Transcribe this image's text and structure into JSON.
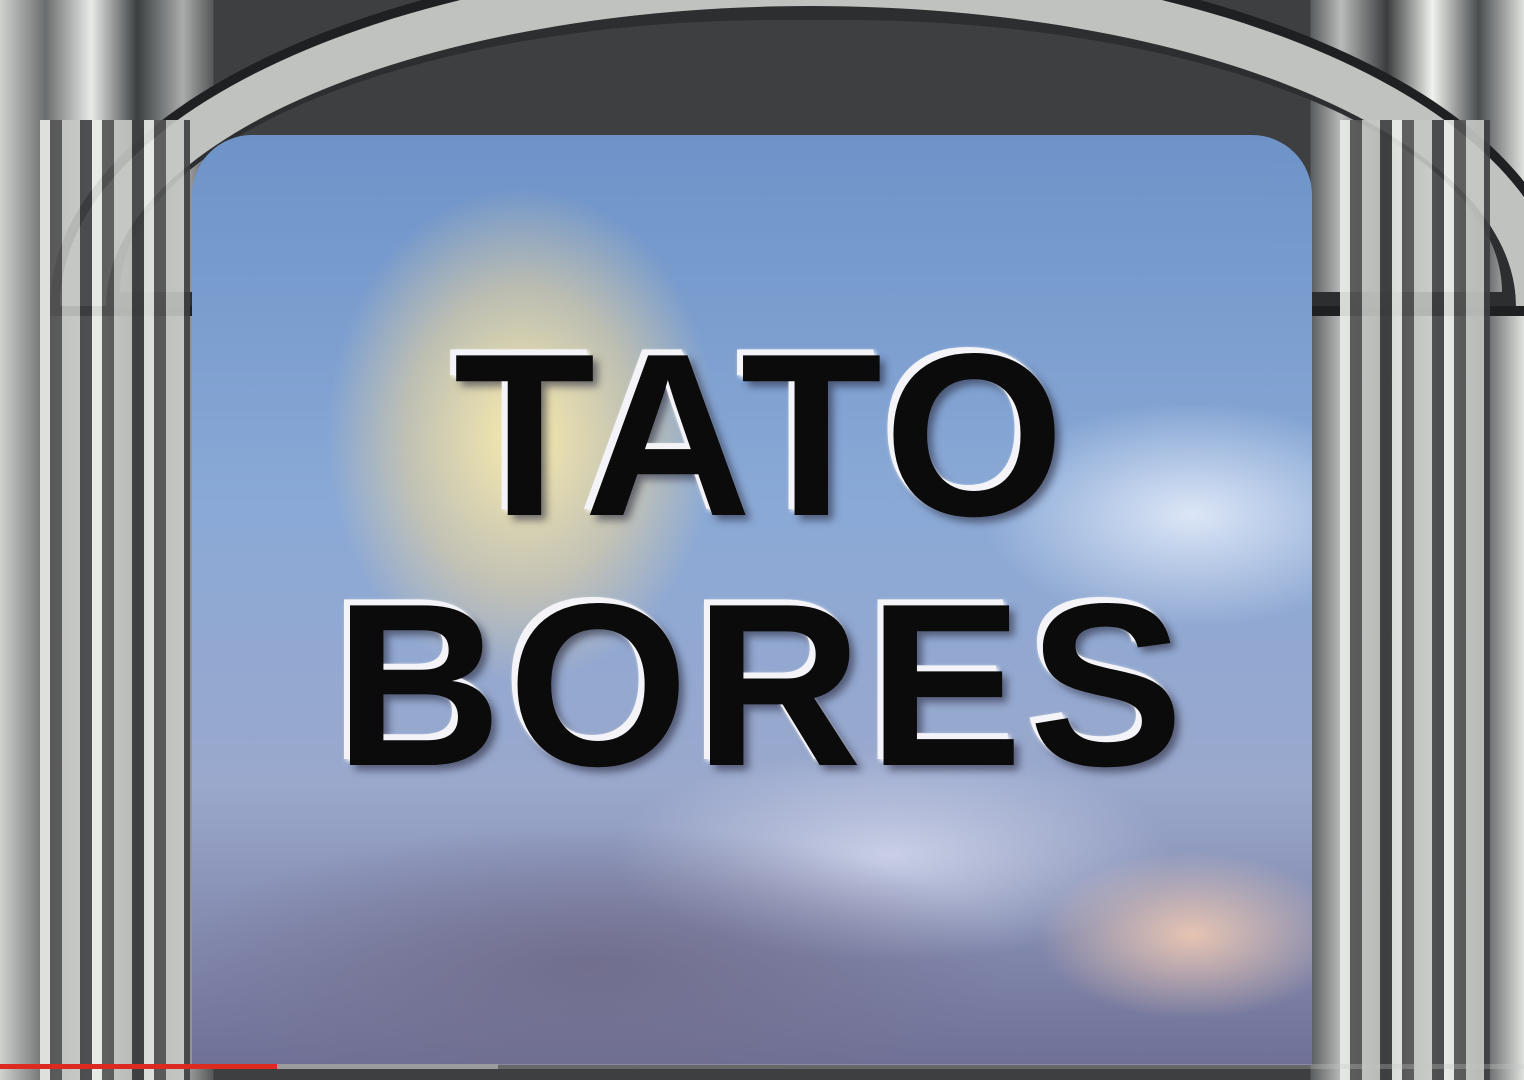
{
  "video": {
    "title_line1": "TATO",
    "title_line2": "BORES",
    "progress": {
      "played_percent": 18.2,
      "buffered_percent": 32.7,
      "played_color": "#dc2a22",
      "buffered_color": "#9b9c9d"
    }
  }
}
